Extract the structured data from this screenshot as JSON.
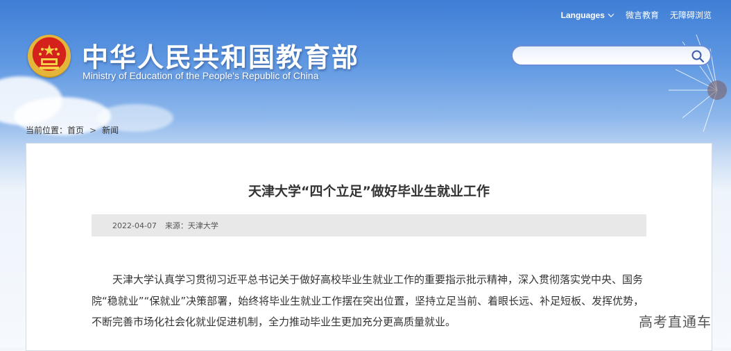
{
  "header": {
    "top_links": {
      "languages": "Languages",
      "weibo": "微言教育",
      "accessibility": "无障碍浏览"
    },
    "site_title": "中华人民共和国教育部",
    "site_subtitle": "Ministry of Education of the People's Republic of China",
    "search": {
      "value": "",
      "placeholder": ""
    }
  },
  "breadcrumb": {
    "prefix": "当前位置：",
    "home": "首页",
    "separator": ">",
    "current": "新闻"
  },
  "article": {
    "title": "天津大学“四个立足”做好毕业生就业工作",
    "date": "2022-04-07",
    "source": "来源：天津大学",
    "paragraph": "天津大学认真学习贯彻习近平总书记关于做好高校毕业生就业工作的重要指示批示精神，深入贯彻落实党中央、国务院“稳就业”“保就业”决策部署，始终将毕业生就业工作摆在突出位置，坚持立足当前、着眼长远、补足短板、发挥优势，不断完善市场化社会化就业促进机制，全力推动毕业生更加充分更高质量就业。"
  },
  "watermark": "高考直通车",
  "colors": {
    "sky_top": "#3f7ed6",
    "emblem_red": "#d4211c",
    "emblem_gold": "#e5b53a",
    "search_border": "#6b8fd6",
    "meta_bar": "#e8e8e8"
  },
  "icons": [
    "national-emblem-icon",
    "chevron-down-icon",
    "search-icon"
  ]
}
